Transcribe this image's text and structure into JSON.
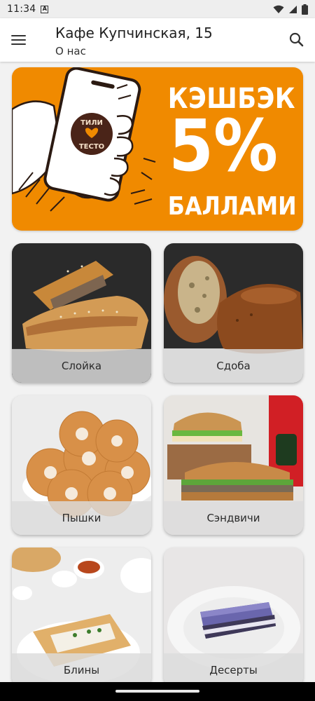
{
  "status_bar": {
    "time": "11:34",
    "notification_badge": "A"
  },
  "header": {
    "title": "Кафе Купчинская, 15",
    "subtitle": "О нас"
  },
  "promo_banner": {
    "line1": "КЭШБЭК",
    "line2": "5%",
    "line3": "БАЛЛАМИ",
    "logo_text_top": "ТИЛИ",
    "logo_text_bottom": "ТЕСТО",
    "color": "#f08a00"
  },
  "categories": [
    {
      "label": "Слойка"
    },
    {
      "label": "Сдоба"
    },
    {
      "label": "Пышки"
    },
    {
      "label": "Сэндвичи"
    },
    {
      "label": "Блины"
    },
    {
      "label": "Десерты"
    }
  ]
}
